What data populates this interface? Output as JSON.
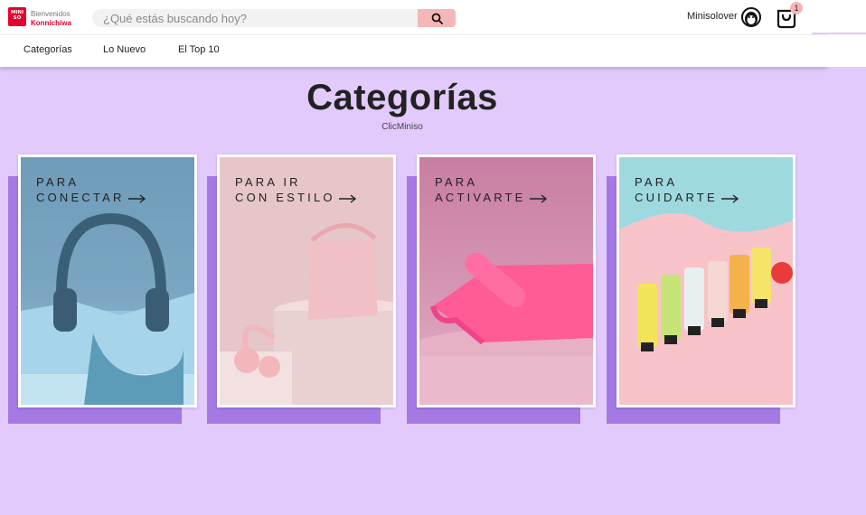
{
  "header": {
    "logo_text": "MINISO",
    "greeting_line1": "Bienvenidos",
    "greeting_line2": "Konnichiwa",
    "search_placeholder": "¿Qué estás buscando hoy?",
    "username": "Minisolover",
    "cart_count": "1"
  },
  "nav": {
    "items": [
      {
        "label": "Categorías"
      },
      {
        "label": "Lo Nuevo"
      },
      {
        "label": "El Top 10"
      }
    ]
  },
  "main": {
    "title": "Categorías",
    "subtitle": "ClicMiniso",
    "cards": [
      {
        "line1": "PARA",
        "line2": "CONECTAR"
      },
      {
        "line1": "PARA IR",
        "line2": "CON ESTILO"
      },
      {
        "line1": "PARA",
        "line2": "ACTIVARTE"
      },
      {
        "line1": "PARA",
        "line2": "CUIDARTE"
      }
    ]
  },
  "colors": {
    "brand_red": "#e6002d",
    "page_bg": "#e2cafc",
    "card_shadow": "#a579e4",
    "search_button": "#f4b7b7"
  }
}
